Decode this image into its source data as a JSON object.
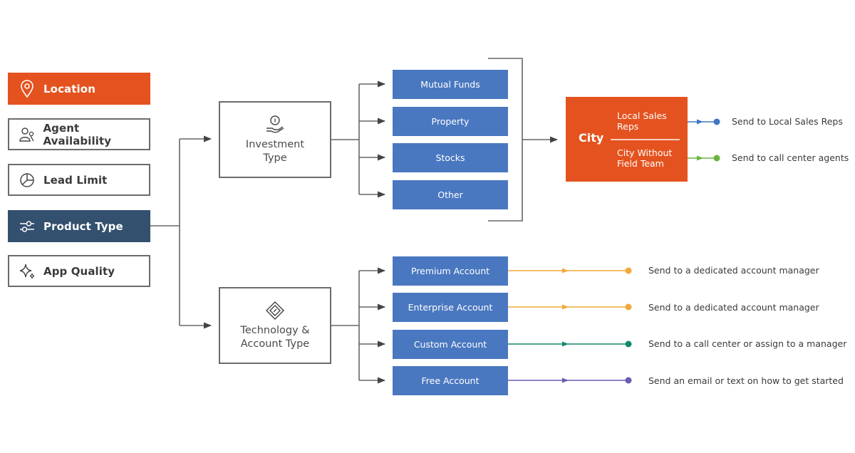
{
  "criteria": [
    {
      "label": "Location",
      "icon": "map-pin-icon",
      "style": "orange"
    },
    {
      "label": "Agent Availability",
      "icon": "users-icon",
      "style": "outline"
    },
    {
      "label": "Lead Limit",
      "icon": "pie-chart-icon",
      "style": "outline"
    },
    {
      "label": "Product Type",
      "icon": "sliders-icon",
      "style": "navy"
    },
    {
      "label": "App Quality",
      "icon": "sparkle-icon",
      "style": "outline"
    }
  ],
  "categories": [
    {
      "label_line1": "Investment",
      "label_line2": "Type",
      "icon": "hand-coin-icon"
    },
    {
      "label_line1": "Technology &",
      "label_line2": "Account Type",
      "icon": "diamond-tag-icon"
    }
  ],
  "investment_options": [
    "Mutual Funds",
    "Property",
    "Stocks",
    "Other"
  ],
  "city": {
    "label": "City",
    "branches": [
      {
        "label_line1": "Local Sales",
        "label_line2": "Reps",
        "outcome": "Send to Local Sales Reps",
        "color": "#3f76c4"
      },
      {
        "label_line1": "City Without",
        "label_line2": "Field Team",
        "outcome": "Send to call center agents",
        "color": "#6ab43e"
      }
    ]
  },
  "account_options": [
    {
      "label": "Premium Account",
      "outcome": "Send to a dedicated account manager",
      "color": "#f2a93b"
    },
    {
      "label": "Enterprise Account",
      "outcome": "Send to a dedicated account manager",
      "color": "#f2a93b"
    },
    {
      "label": "Custom Account",
      "outcome": "Send to a call center or assign to a manager",
      "color": "#118a6c"
    },
    {
      "label": "Free Account",
      "outcome": "Send an email or text on how to get started",
      "color": "#6a5bb0"
    }
  ],
  "colors": {
    "orange": "#e4531f",
    "navy": "#34506f",
    "blue_box": "#4a78c0",
    "connector": "#555555"
  }
}
